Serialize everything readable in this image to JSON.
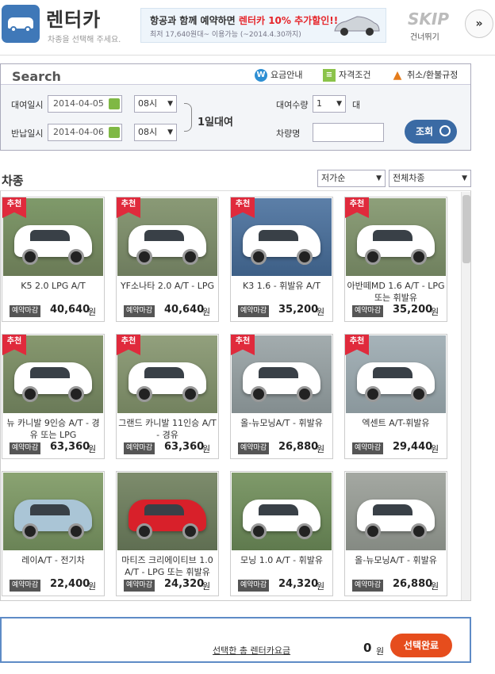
{
  "header": {
    "title": "렌터카",
    "subtitle": "차종을 선택해 주세요.",
    "banner_line1_a": "항공과 함께 예약하면 ",
    "banner_line1_b": "렌터카 10% 추가할인!!",
    "banner_line2": "최저 17,640원대~ 이용가능  (~2014.4.30까지)",
    "skip": "SKIP",
    "skip_sub": "건너뛰기",
    "skip_arrow": "»"
  },
  "search": {
    "title": "Search",
    "links": {
      "fee": "요금안내",
      "qualification": "자격조건",
      "cancel": "취소/환불규정"
    },
    "rent_label": "대여일시",
    "rent_date": "2014-04-05",
    "rent_hour": "08시",
    "return_label": "반납일시",
    "return_date": "2014-04-06",
    "return_hour": "08시",
    "duration": "1일대여",
    "qty_label": "대여수량",
    "qty_value": "1",
    "qty_unit": "대",
    "carname_label": "차량명",
    "search_button": "조회"
  },
  "list": {
    "heading": "차종",
    "sort_value": "저가순",
    "type_value": "전체차종",
    "reserve_badge": "예약마감",
    "won": "원",
    "rec_label": "추천",
    "cars": [
      {
        "name": "K5 2.0 LPG A/T",
        "price": "40,640",
        "rec": true
      },
      {
        "name": "YF소나타 2.0 A/T - LPG",
        "price": "40,640",
        "rec": true
      },
      {
        "name": "K3 1.6 - 휘발유 A/T",
        "price": "35,200",
        "rec": true
      },
      {
        "name": "아반떼MD 1.6 A/T - LPG 또는 휘발유",
        "price": "35,200",
        "rec": true
      },
      {
        "name": "뉴 카니발 9인승 A/T - 경유 또는 LPG",
        "price": "63,360",
        "rec": true
      },
      {
        "name": "그랜드 카니발 11인승 A/T - 경유",
        "price": "63,360",
        "rec": true
      },
      {
        "name": "올-뉴모닝A/T - 휘발유",
        "price": "26,880",
        "rec": true
      },
      {
        "name": "엑센트 A/T-휘발유",
        "price": "29,440",
        "rec": true
      },
      {
        "name": "레이A/T - 전기차",
        "price": "22,400",
        "rec": false
      },
      {
        "name": "마티즈 크리에이티브 1.0 A/T - LPG 또는 휘발유",
        "price": "24,320",
        "rec": false
      },
      {
        "name": "모닝 1.0 A/T - 휘발유",
        "price": "24,320",
        "rec": false
      },
      {
        "name": "올-뉴모닝A/T - 휘발유",
        "price": "26,880",
        "rec": false
      }
    ]
  },
  "colors": {
    "brand_blue": "#3f78b8",
    "rec_red": "#e02a3c",
    "confirm_orange": "#e64d1d"
  },
  "footer": {
    "selected_text": "선택한 총 렌터카요금",
    "amount": "0",
    "won": "원",
    "confirm_button": "선택완료"
  }
}
